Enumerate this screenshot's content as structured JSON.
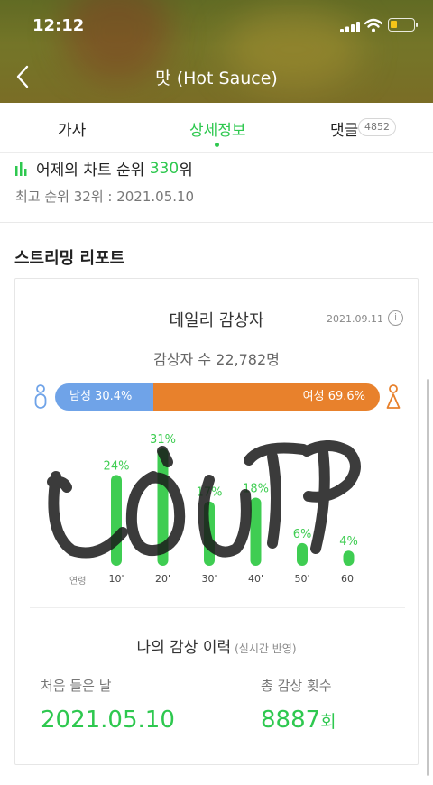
{
  "status_bar": {
    "time": "12:12"
  },
  "header": {
    "title": "맛 (Hot Sauce)"
  },
  "tabs": [
    {
      "label": "가사"
    },
    {
      "label": "상세정보"
    },
    {
      "label": "댓글",
      "badge": "4852"
    }
  ],
  "ranking": {
    "prefix": "어제의 차트 순위",
    "rank": "330",
    "suffix": "위",
    "best": "최고 순위 32위 : 2021.05.10"
  },
  "report": {
    "title": "스트리밍 리포트",
    "card_heading": "데일리 감상자",
    "date": "2021.09.11",
    "listener_count": "감상자 수 22,782명",
    "male_label": "남성 30.4%",
    "female_label": "여성 69.6%",
    "male_fraction": 0.304
  },
  "chart_data": {
    "type": "bar",
    "age_label": "연령",
    "categories": [
      "10'",
      "20'",
      "30'",
      "40'",
      "50'",
      "60'"
    ],
    "values": [
      24,
      31,
      17,
      18,
      6,
      4
    ],
    "value_labels": [
      "24%",
      "31%",
      "17%",
      "18%",
      "6%",
      "4%"
    ],
    "ylim": [
      0,
      31
    ],
    "color": "#3fcd52"
  },
  "history": {
    "title": "나의 감상 이력",
    "note": "(실시간 반영)",
    "first_label": "처음 들은 날",
    "first_value": "2021.05.10",
    "total_label": "총 감상 횟수",
    "total_value": "8887",
    "total_unit": "회"
  },
  "colors": {
    "accent": "#2ec84f",
    "male": "#6fa3e8",
    "female": "#e8812c"
  }
}
